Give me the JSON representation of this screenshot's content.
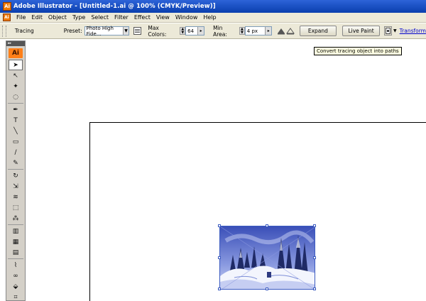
{
  "window": {
    "title": "Adobe Illustrator - [Untitled-1.ai @ 100% (CMYK/Preview)]",
    "app_icon_text": "Ai"
  },
  "menu": {
    "items": [
      "File",
      "Edit",
      "Object",
      "Type",
      "Select",
      "Filter",
      "Effect",
      "View",
      "Window",
      "Help"
    ]
  },
  "control_bar": {
    "mode_label": "Tracing",
    "preset_label": "Preset:",
    "preset_value": "Photo High Fide...",
    "max_colors_label": "Max Colors:",
    "max_colors_value": "64",
    "min_area_label": "Min Area:",
    "min_area_value": "4 px",
    "expand_label": "Expand",
    "live_paint_label": "Live Paint",
    "transform_link": "Transform"
  },
  "tooltip": {
    "text": "Convert tracing object into paths"
  },
  "tools_panel": {
    "logo_text": "Ai",
    "tools": [
      {
        "name": "selection-tool",
        "glyph": "➤",
        "active": true
      },
      {
        "name": "direct-selection-tool",
        "glyph": "↖"
      },
      {
        "name": "magic-wand-tool",
        "glyph": "✦"
      },
      {
        "name": "lasso-tool",
        "glyph": "◌"
      },
      {
        "name": "pen-tool",
        "glyph": "✒"
      },
      {
        "name": "type-tool",
        "glyph": "T"
      },
      {
        "name": "line-tool",
        "glyph": "╲"
      },
      {
        "name": "rectangle-tool",
        "glyph": "▭"
      },
      {
        "name": "paintbrush-tool",
        "glyph": "∕"
      },
      {
        "name": "pencil-tool",
        "glyph": "✎"
      },
      {
        "name": "rotate-tool",
        "glyph": "↻"
      },
      {
        "name": "scale-tool",
        "glyph": "⇲"
      },
      {
        "name": "warp-tool",
        "glyph": "≋"
      },
      {
        "name": "free-transform-tool",
        "glyph": "⬚"
      },
      {
        "name": "symbol-sprayer-tool",
        "glyph": "⁂"
      },
      {
        "name": "column-graph-tool",
        "glyph": "▥"
      },
      {
        "name": "mesh-tool",
        "glyph": "▦"
      },
      {
        "name": "gradient-tool",
        "glyph": "▤"
      },
      {
        "name": "eyedropper-tool",
        "glyph": "⌇"
      },
      {
        "name": "blend-tool",
        "glyph": "∞"
      },
      {
        "name": "live-paint-bucket-tool",
        "glyph": "⬙"
      },
      {
        "name": "slice-tool",
        "glyph": "⌗"
      }
    ]
  },
  "colors": {
    "title_bar": "#0a3fae",
    "chrome": "#ece9d8",
    "ai_orange": "#ff7f18",
    "selection_blue": "#3a5ac0"
  }
}
